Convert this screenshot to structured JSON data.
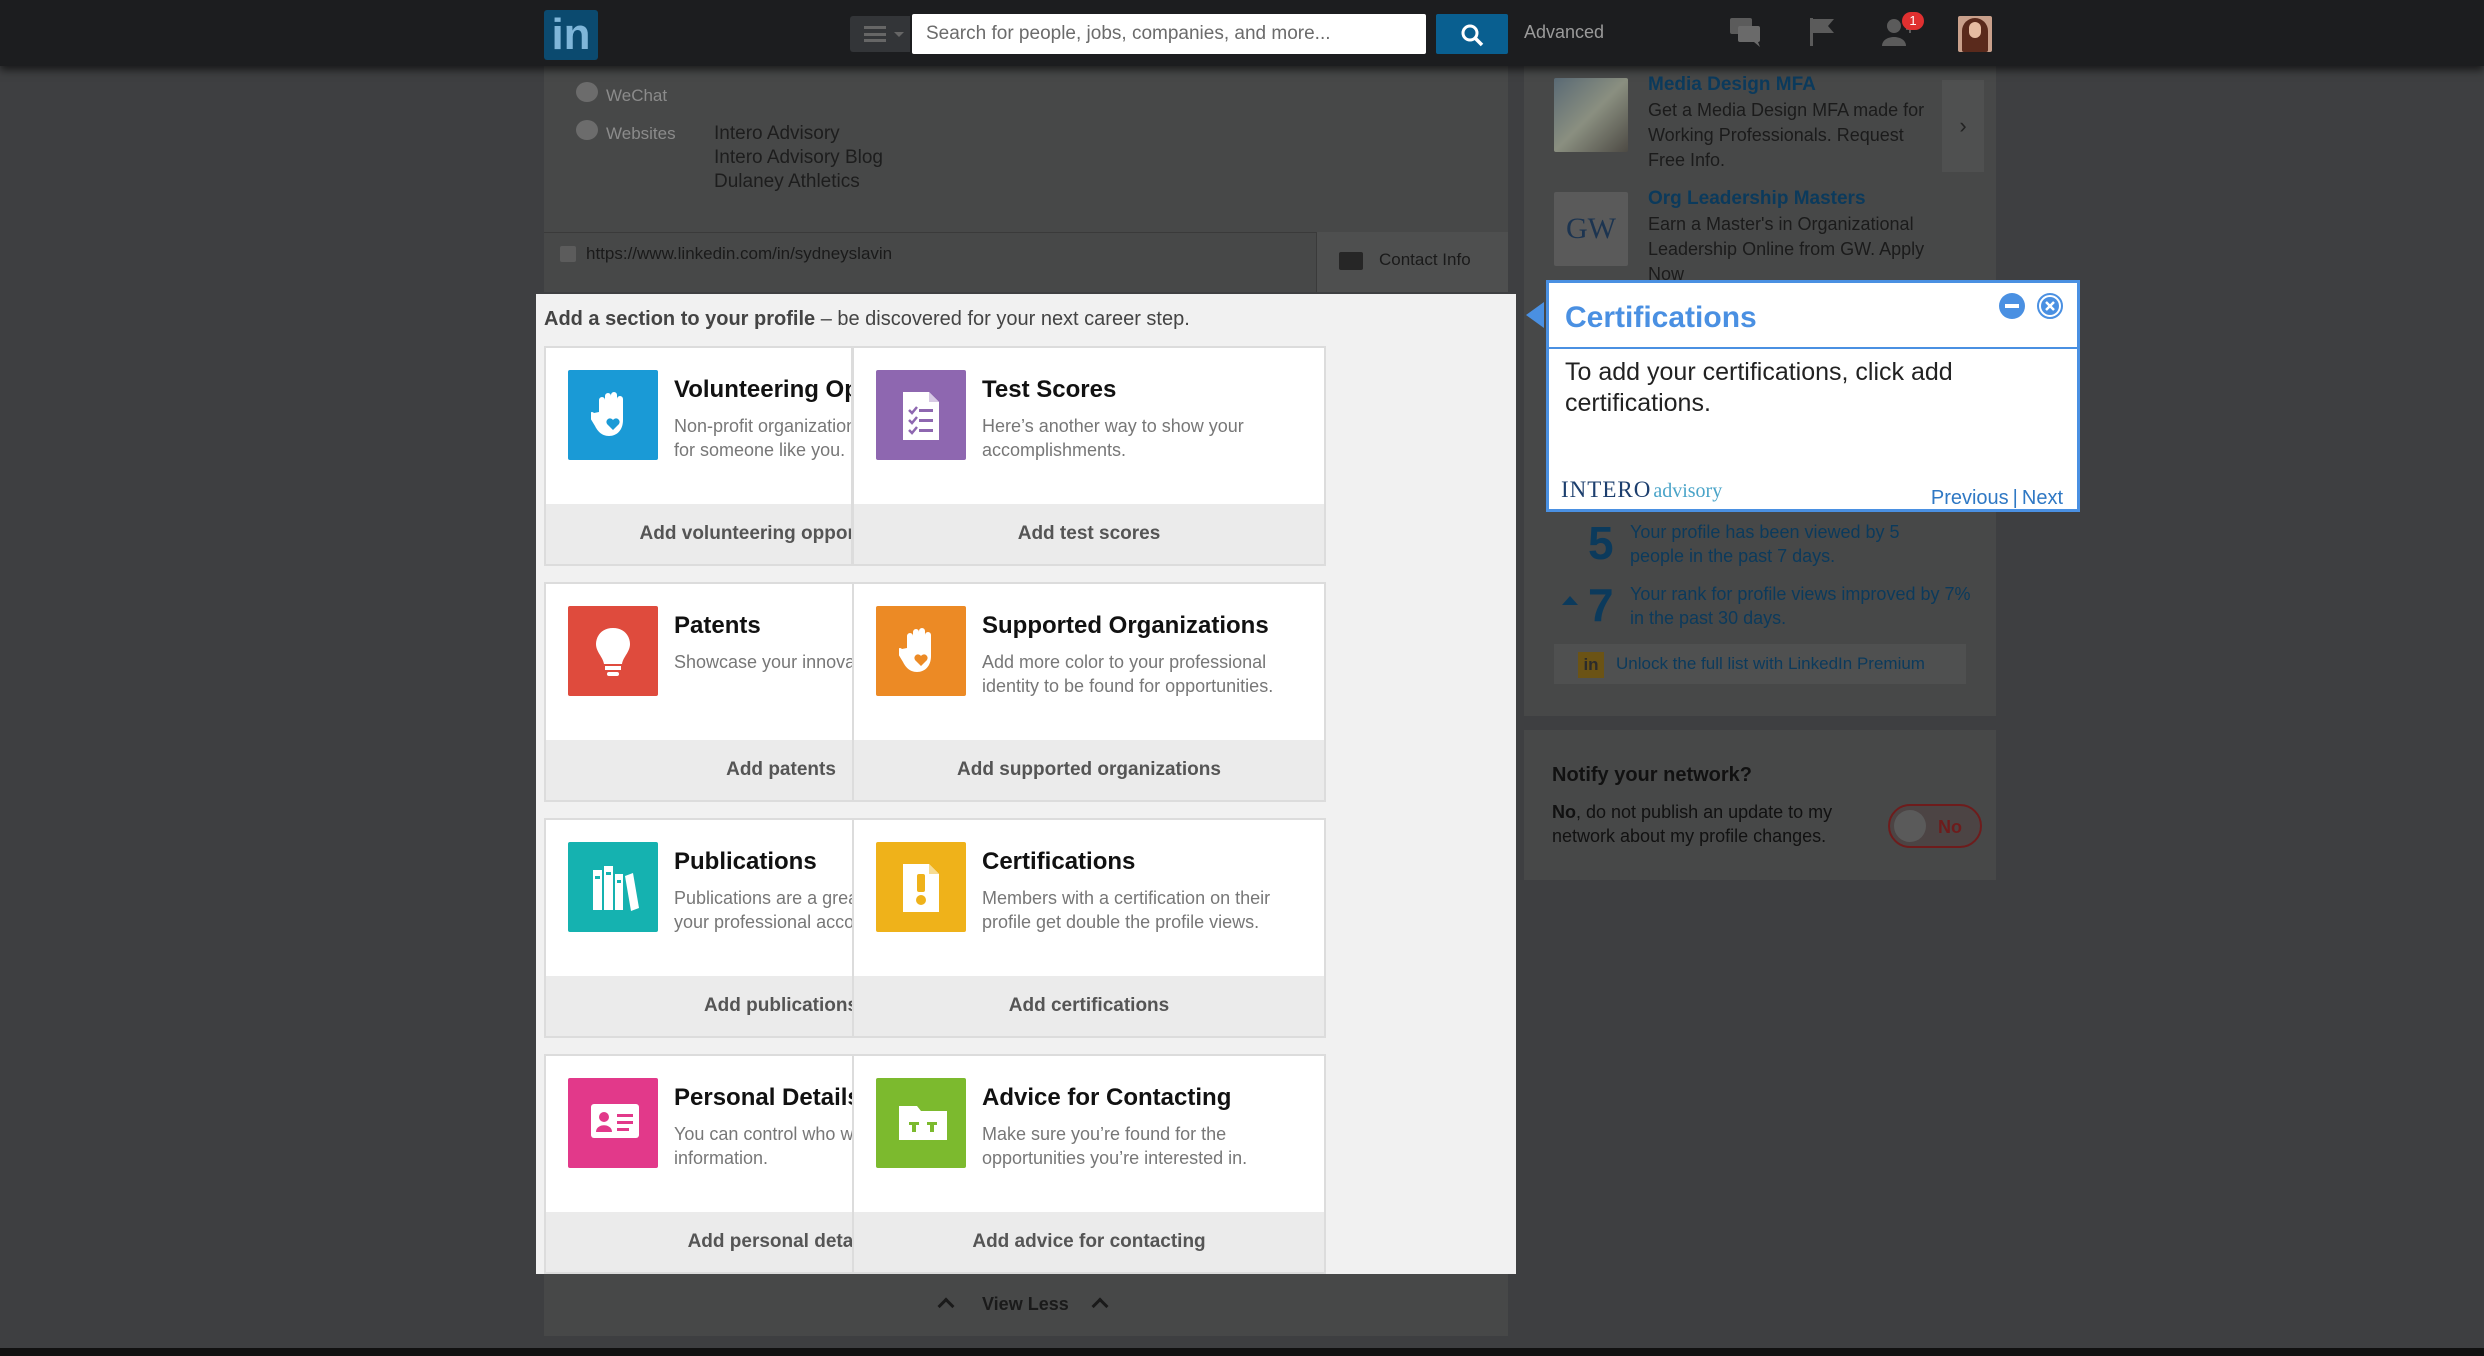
{
  "topnav": {
    "logo": "in",
    "search_placeholder": "Search for people, jobs, companies, and more...",
    "advanced": "Advanced",
    "notification_count": "1"
  },
  "profile": {
    "wechat_label": "WeChat",
    "websites_label": "Websites",
    "websites": [
      "Intero Advisory",
      "Intero Advisory Blog",
      "Dulaney Athletics"
    ],
    "url": "https://www.linkedin.com/in/sydneyslavin",
    "contact_info": "Contact Info"
  },
  "add_section": {
    "header_bold": "Add a section to your profile",
    "header_rest": " – be discovered for your next career step.",
    "cards": [
      {
        "title": "Volunteering Opportunities",
        "desc": "Non-profit organizations could be looking for someone like you.",
        "action": "Add volunteering opportunities",
        "color": "#1a9ad6",
        "icon": "hand-heart-icon"
      },
      {
        "title": "Test Scores",
        "desc": "Here’s another way to show your accomplishments.",
        "action": "Add test scores",
        "color": "#8e67b0",
        "icon": "checklist-icon"
      },
      {
        "title": "Patents",
        "desc": "Showcase your innovation and expertise.",
        "action": "Add patents",
        "color": "#df4b3d",
        "icon": "lightbulb-icon"
      },
      {
        "title": "Supported Organizations",
        "desc": "Add more color to your professional identity to be found for opportunities.",
        "action": "Add supported organizations",
        "color": "#ec8a25",
        "icon": "hand-heart-icon"
      },
      {
        "title": "Publications",
        "desc": "Publications are a great way to show off your professional accomplishments.",
        "action": "Add publications",
        "color": "#15b2b0",
        "icon": "books-icon"
      },
      {
        "title": "Certifications",
        "desc": "Members with a certification on their profile get double the profile views.",
        "action": "Add certifications",
        "color": "#efb21a",
        "icon": "certificate-icon"
      },
      {
        "title": "Personal Details",
        "desc": "You can control who will see this information.",
        "action": "Add personal details",
        "color": "#e2398a",
        "icon": "id-card-icon"
      },
      {
        "title": "Advice for Contacting",
        "desc": "Make sure you’re found for the opportunities you’re interested in.",
        "action": "Add advice for contacting",
        "color": "#7cba2e",
        "icon": "folder-icon"
      }
    ],
    "view_less": "View Less"
  },
  "popup": {
    "title": "Certifications",
    "body": "To add your certifications, click add certifications.",
    "brand": "INTERO",
    "brand_suffix": "advisory",
    "previous": "Previous",
    "separator": "|",
    "next": "Next",
    "accent": "#4a90e2"
  },
  "rail": {
    "ads": [
      {
        "title": "Media Design MFA",
        "text": "Get a Media Design MFA made for Working Professionals. Request Free Info."
      },
      {
        "title": "Org Leadership Masters",
        "text": "Earn a Master's in Organizational Leadership Online from GW. Apply Now"
      }
    ],
    "ad2_logo": "GW",
    "ad_chevron": "›",
    "stats": [
      {
        "num": "5",
        "text": "Your profile has been viewed by 5 people in the past 7 days."
      },
      {
        "num": "7",
        "text": "Your rank for profile views improved by 7% in the past 30 days."
      }
    ],
    "premium_logo": "in",
    "premium": "Unlock the full list with LinkedIn Premium",
    "notify_title": "Notify your network?",
    "notify_bold": "No",
    "notify_rest": ", do not publish an update to my network about my profile changes.",
    "toggle_label": "No"
  }
}
